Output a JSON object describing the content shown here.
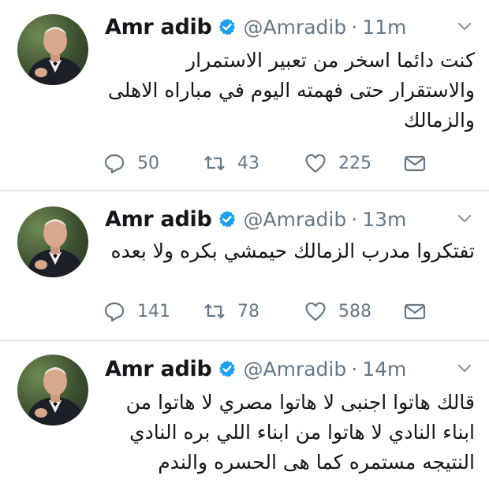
{
  "tweets": [
    {
      "name": "Amr adib",
      "handle": "@Amradib",
      "separator": "·",
      "time": "11m",
      "text": "كنت دائما اسخر من تعبير الاستمرار والاستقرار حتى فهمته اليوم في مباراه الاهلى والزمالك",
      "replies": "50",
      "retweets": "43",
      "likes": "225"
    },
    {
      "name": "Amr adib",
      "handle": "@Amradib",
      "separator": "·",
      "time": "13m",
      "text": "تفتكروا مدرب الزمالك حيمشي بكره ولا بعده",
      "replies": "141",
      "retweets": "78",
      "likes": "588"
    },
    {
      "name": "Amr adib",
      "handle": "@Amradib",
      "separator": "·",
      "time": "14m",
      "text": "قالك هاتوا اجنبى لا هاتوا مصري لا هاتوا من ابناء النادي لا هاتوا من ابناء اللي بره النادي النتيجه مستمره كما هى الحسره والندم",
      "replies": "",
      "retweets": "",
      "likes": ""
    }
  ],
  "icons": {
    "verified": "verified-badge-icon",
    "caret": "chevron-down-icon",
    "reply": "reply-icon",
    "retweet": "retweet-icon",
    "like": "heart-icon",
    "dm": "envelope-icon"
  },
  "colors": {
    "verified": "#1da1f2",
    "text": "#14171a",
    "muted": "#657786",
    "divider": "#e1e8ed"
  }
}
